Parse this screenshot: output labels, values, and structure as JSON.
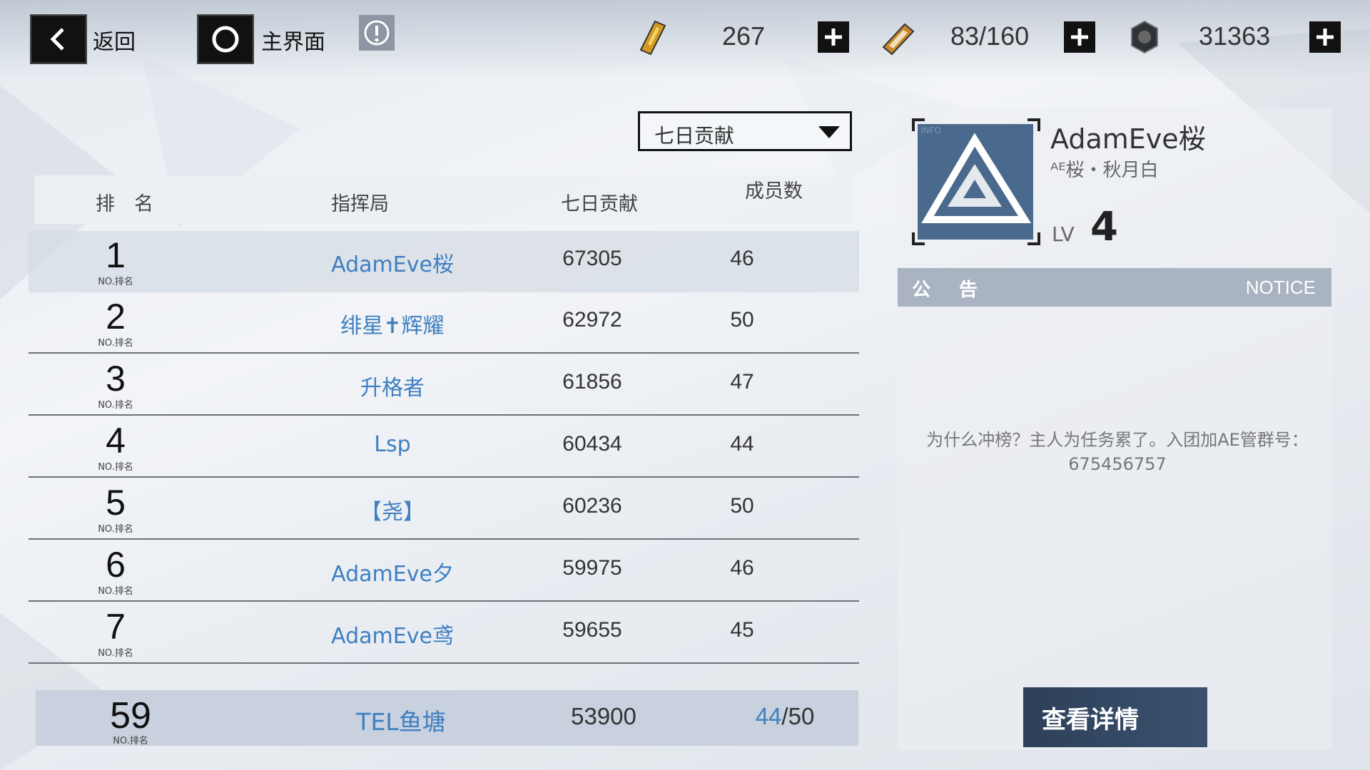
{
  "topbar": {
    "back_label": "返回",
    "home_label": "主界面",
    "resources": [
      {
        "icon": "ticket-icon",
        "value": "267"
      },
      {
        "icon": "battery-icon",
        "value": "83/160"
      },
      {
        "icon": "gear-coin-icon",
        "value": "31363"
      }
    ]
  },
  "filter": {
    "selected": "七日贡献"
  },
  "table": {
    "headers": {
      "rank": "排　名",
      "command": "指挥局",
      "contribution": "七日贡献",
      "members": "成员数"
    },
    "rank_sub": "NO.排名",
    "rows": [
      {
        "rank": "1",
        "name": "AdamEve桜",
        "contribution": "67305",
        "members": "46"
      },
      {
        "rank": "2",
        "name": "绯星✝辉耀",
        "contribution": "62972",
        "members": "50"
      },
      {
        "rank": "3",
        "name": "升格者",
        "contribution": "61856",
        "members": "47"
      },
      {
        "rank": "4",
        "name": "Lsp",
        "contribution": "60434",
        "members": "44"
      },
      {
        "rank": "5",
        "name": "【尧】",
        "contribution": "60236",
        "members": "50"
      },
      {
        "rank": "6",
        "name": "AdamEve夕",
        "contribution": "59975",
        "members": "46"
      },
      {
        "rank": "7",
        "name": "AdamEve鸢",
        "contribution": "59655",
        "members": "45"
      }
    ],
    "self": {
      "rank": "59",
      "name": "TEL鱼塘",
      "contribution": "53900",
      "members_current": "44",
      "members_max": "/50"
    }
  },
  "guild": {
    "emblem_tag": "INFO",
    "name": "AdamEve桜",
    "leader": "ᴬᴱ桜・秋月白",
    "lv_label": "LV",
    "level": "4",
    "notice_title": "公告",
    "notice_en": "NOTICE",
    "notice_text": "为什么冲榜？主人为任务累了。入团加AE管群号：675456757",
    "detail_button": "查看详情"
  },
  "colors": {
    "accent_blue": "#3f7fc2",
    "dark_button": "#111111",
    "notice_bar": "#a9b3c1"
  }
}
